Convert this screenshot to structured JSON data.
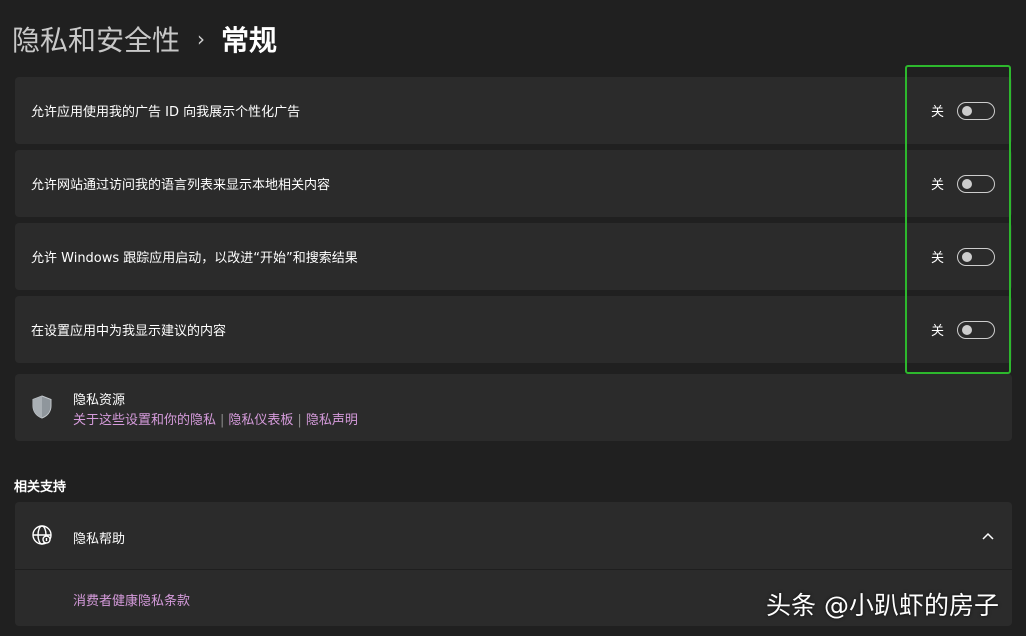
{
  "header": {
    "parent": "隐私和安全性",
    "separator": "›",
    "current": "常规"
  },
  "settings": [
    {
      "label": "允许应用使用我的广告 ID 向我展示个性化广告",
      "state": "关",
      "on": false
    },
    {
      "label": "允许网站通过访问我的语言列表来显示本地相关内容",
      "state": "关",
      "on": false
    },
    {
      "label": "允许 Windows 跟踪应用启动，以改进“开始”和搜索结果",
      "state": "关",
      "on": false
    },
    {
      "label": "在设置应用中为我显示建议的内容",
      "state": "关",
      "on": false
    }
  ],
  "privacy_resources": {
    "icon": "shield-icon",
    "title": "隐私资源",
    "links": [
      "关于这些设置和你的隐私",
      "隐私仪表板",
      "隐私声明"
    ],
    "link_separator": "|"
  },
  "related_support": {
    "title": "相关支持",
    "item": {
      "icon": "globe-icon",
      "label": "隐私帮助",
      "expanded": true,
      "links": [
        "消费者健康隐私条款"
      ]
    }
  },
  "watermark": "头条 @小趴虾的房子",
  "colors": {
    "background": "#202020",
    "card": "#2b2b2b",
    "link": "#d59bdb",
    "highlight": "#2db82d",
    "toggle_off": "#cdcdcd"
  }
}
